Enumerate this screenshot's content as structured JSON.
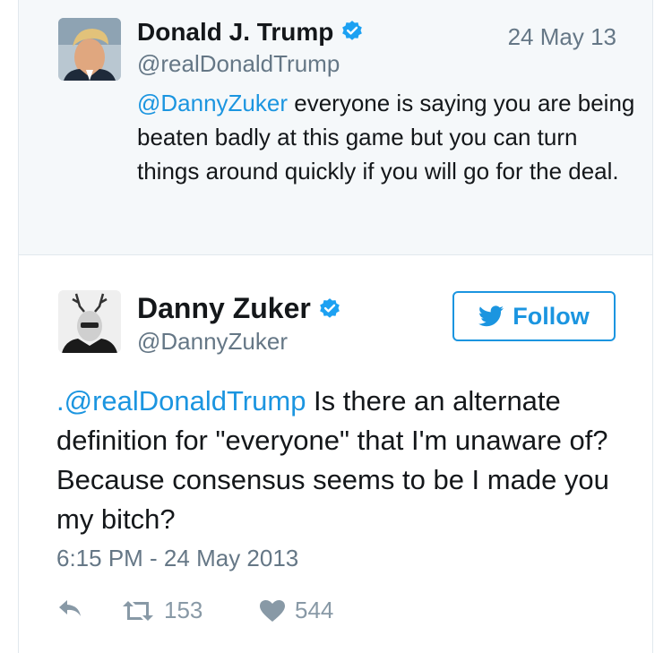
{
  "parent_tweet": {
    "author_name": "Donald J. Trump",
    "handle": "@realDonaldTrump",
    "date": "24 May 13",
    "mention": "@DannyZuker",
    "text": " everyone is saying you are being beaten badly at this game but you can turn things around quickly if you will go for the deal."
  },
  "main_tweet": {
    "author_name": "Danny Zuker",
    "handle": "@DannyZuker",
    "follow_label": "Follow",
    "prefix": ".",
    "mention": "@realDonaldTrump",
    "text": " Is there an alternate definition for \"everyone\" that I'm unaware of? Because consensus seems to be I made you my bitch?",
    "timestamp": "6:15 PM - 24 May 2013",
    "retweets": "153",
    "likes": "544"
  },
  "colors": {
    "link": "#1b95e0",
    "muted": "#657786",
    "verified": "#1da1f2"
  },
  "icons": [
    "verified-badge-icon",
    "twitter-bird-icon",
    "reply-icon",
    "retweet-icon",
    "heart-icon"
  ]
}
